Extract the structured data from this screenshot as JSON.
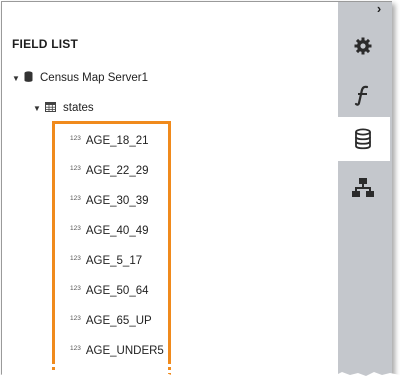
{
  "panel": {
    "title": "FIELD LIST",
    "collapse_icon": "chevron-right-icon"
  },
  "tree": {
    "server": {
      "label": "Census Map Server1",
      "icon": "database-icon",
      "expanded": true
    },
    "table": {
      "label": "states",
      "icon": "table-grid-icon",
      "expanded": true
    },
    "fields": [
      {
        "label": "AGE_18_21",
        "type_icon": "123"
      },
      {
        "label": "AGE_22_29",
        "type_icon": "123"
      },
      {
        "label": "AGE_30_39",
        "type_icon": "123"
      },
      {
        "label": "AGE_40_49",
        "type_icon": "123"
      },
      {
        "label": "AGE_5_17",
        "type_icon": "123"
      },
      {
        "label": "AGE_50_64",
        "type_icon": "123"
      },
      {
        "label": "AGE_65_UP",
        "type_icon": "123"
      },
      {
        "label": "AGE_UNDER5",
        "type_icon": "123"
      }
    ]
  },
  "rail": {
    "tabs": [
      {
        "icon": "gear-icon",
        "active": false
      },
      {
        "icon": "function-icon",
        "active": false
      },
      {
        "icon": "database-icon",
        "active": true
      },
      {
        "icon": "hierarchy-icon",
        "active": false
      }
    ]
  },
  "colors": {
    "highlight": "#f08a1c",
    "rail": "#c4c7cc"
  }
}
